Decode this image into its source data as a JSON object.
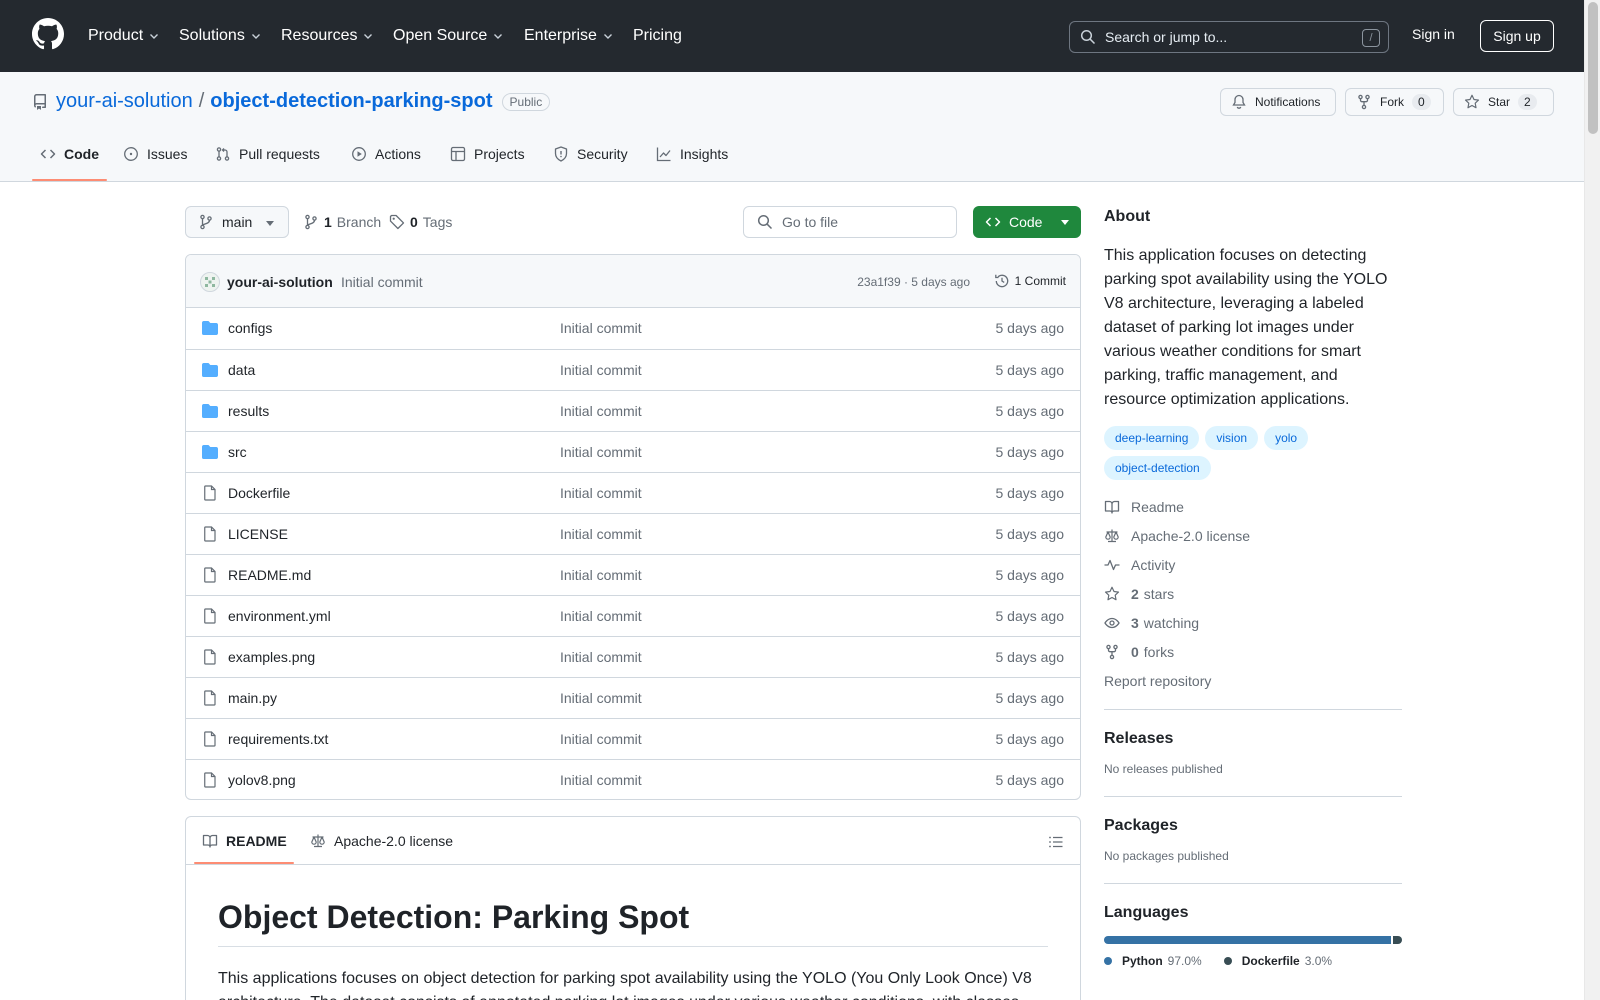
{
  "header": {
    "nav": [
      {
        "label": "Product",
        "icon": "chevron-down-icon"
      },
      {
        "label": "Solutions",
        "icon": "chevron-down-icon"
      },
      {
        "label": "Resources",
        "icon": "chevron-down-icon"
      },
      {
        "label": "Open Source",
        "icon": "chevron-down-icon"
      },
      {
        "label": "Enterprise",
        "icon": "chevron-down-icon"
      },
      {
        "label": "Pricing"
      }
    ],
    "search_placeholder": "Search or jump to...",
    "search_shortcut": "/",
    "sign_in": "Sign in",
    "sign_up": "Sign up"
  },
  "repo": {
    "owner": "your-ai-solution",
    "separator": "/",
    "name": "object-detection-parking-spot",
    "visibility": "Public",
    "notifications_label": "Notifications",
    "fork_label": "Fork",
    "fork_count": "0",
    "star_label": "Star",
    "star_count": "2"
  },
  "tabs": [
    {
      "label": "Code",
      "icon": "code-icon",
      "active": true
    },
    {
      "label": "Issues",
      "icon": "issue-icon"
    },
    {
      "label": "Pull requests",
      "icon": "pull-request-icon"
    },
    {
      "label": "Actions",
      "icon": "play-icon"
    },
    {
      "label": "Projects",
      "icon": "table-icon"
    },
    {
      "label": "Security",
      "icon": "shield-icon"
    },
    {
      "label": "Insights",
      "icon": "graph-icon"
    }
  ],
  "toolbar": {
    "branch": "main",
    "branch_count": "1",
    "branch_label": "Branch",
    "tag_count": "0",
    "tag_label": "Tags",
    "goto_placeholder": "Go to file",
    "code_button": "Code"
  },
  "latest_commit": {
    "author": "your-ai-solution",
    "message": "Initial commit",
    "hash_age": "23a1f39 · 5 days ago",
    "commit_count": "1 Commit"
  },
  "files": [
    {
      "name": "configs",
      "type": "dir",
      "message": "Initial commit",
      "age": "5 days ago"
    },
    {
      "name": "data",
      "type": "dir",
      "message": "Initial commit",
      "age": "5 days ago"
    },
    {
      "name": "results",
      "type": "dir",
      "message": "Initial commit",
      "age": "5 days ago"
    },
    {
      "name": "src",
      "type": "dir",
      "message": "Initial commit",
      "age": "5 days ago"
    },
    {
      "name": "Dockerfile",
      "type": "file",
      "message": "Initial commit",
      "age": "5 days ago"
    },
    {
      "name": "LICENSE",
      "type": "file",
      "message": "Initial commit",
      "age": "5 days ago"
    },
    {
      "name": "README.md",
      "type": "file",
      "message": "Initial commit",
      "age": "5 days ago"
    },
    {
      "name": "environment.yml",
      "type": "file",
      "message": "Initial commit",
      "age": "5 days ago"
    },
    {
      "name": "examples.png",
      "type": "file",
      "message": "Initial commit",
      "age": "5 days ago"
    },
    {
      "name": "main.py",
      "type": "file",
      "message": "Initial commit",
      "age": "5 days ago"
    },
    {
      "name": "requirements.txt",
      "type": "file",
      "message": "Initial commit",
      "age": "5 days ago"
    },
    {
      "name": "yolov8.png",
      "type": "file",
      "message": "Initial commit",
      "age": "5 days ago"
    }
  ],
  "readme": {
    "tab_readme": "README",
    "tab_license": "Apache-2.0 license",
    "title": "Object Detection: Parking Spot",
    "body": "This applications focuses on object detection for parking spot availability using the YOLO (You Only Look Once) V8 architecture. The dataset consists of annotated parking lot images under various weather conditions, with classes"
  },
  "about": {
    "heading": "About",
    "description": "This application focuses on detecting parking spot availability using the YOLO V8 architecture, leveraging a labeled dataset of parking lot images under various weather conditions for smart parking, traffic management, and resource optimization applications.",
    "topics": [
      "deep-learning",
      "vision",
      "yolo",
      "object-detection"
    ],
    "readme": "Readme",
    "license": "Apache-2.0 license",
    "activity": "Activity",
    "stars_count": "2",
    "stars_label": "stars",
    "watching_count": "3",
    "watching_label": "watching",
    "forks_count": "0",
    "forks_label": "forks",
    "report": "Report repository"
  },
  "releases": {
    "heading": "Releases",
    "text": "No releases published"
  },
  "packages": {
    "heading": "Packages",
    "text": "No packages published"
  },
  "languages": {
    "heading": "Languages",
    "items": [
      {
        "name": "Python",
        "percent": "97.0%",
        "share": 97.0,
        "color": "#3572A5"
      },
      {
        "name": "Dockerfile",
        "percent": "3.0%",
        "share": 3.0,
        "color": "#384d54"
      }
    ]
  },
  "colors": {
    "header_bg": "#24292f",
    "link": "#0969da",
    "primary_button": "#1f883d",
    "tab_underline": "#fd8c73",
    "folder": "#54aeff"
  }
}
